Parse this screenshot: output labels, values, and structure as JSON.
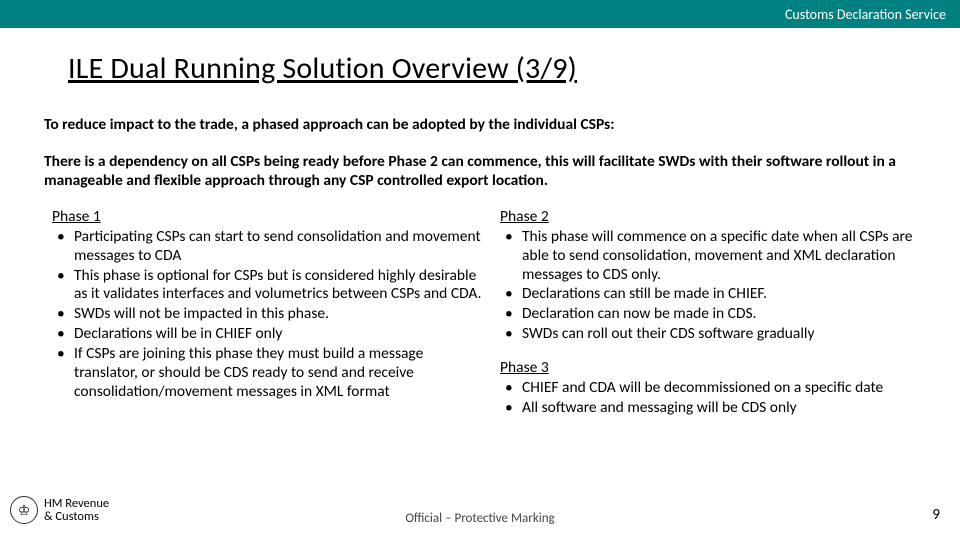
{
  "header": {
    "service": "Customs Declaration Service"
  },
  "title": "ILE Dual Running Solution Overview (3/9)",
  "intro1": "To reduce impact to the trade, a phased approach can be adopted by the individual CSPs:",
  "intro2": "There is a dependency on all CSPs being ready before Phase 2 can commence, this will facilitate SWDs with their software rollout in a manageable and flexible approach through any CSP controlled export location.",
  "left": {
    "phase1": {
      "title": "Phase 1",
      "items": [
        "Participating CSPs can start to send consolidation and movement messages to CDA",
        "This phase is optional for CSPs but is considered highly desirable as it validates interfaces and volumetrics between CSPs and CDA.",
        "SWDs will not be impacted in this phase.",
        "Declarations will be in CHIEF only",
        "If CSPs are joining this phase they must build a message translator, or should be CDS ready to send and receive consolidation/movement messages in XML format"
      ]
    }
  },
  "right": {
    "phase2": {
      "title": "Phase 2",
      "items": [
        "This phase will commence on a specific date when all CSPs are able to send consolidation, movement and XML declaration messages to CDS only.",
        "Declarations can still be made in CHIEF.",
        "Declaration can now be made in CDS.",
        "SWDs can roll out their CDS software gradually"
      ]
    },
    "phase3": {
      "title": "Phase 3",
      "items": [
        "CHIEF and CDA will be decommissioned on a specific date",
        "All software and messaging will be CDS only"
      ]
    }
  },
  "footer": {
    "org_line1": "HM Revenue",
    "org_line2": "& Customs",
    "marking": "Official – Protective Marking",
    "page": "9"
  }
}
